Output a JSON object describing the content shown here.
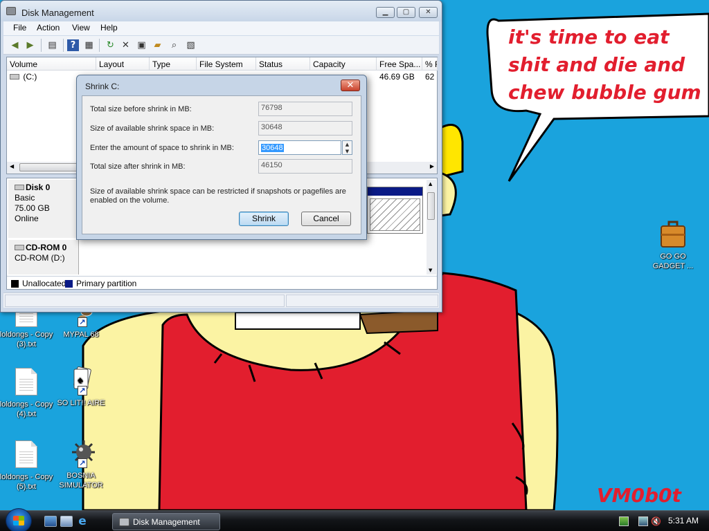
{
  "colors": {
    "desktop_sky": "#1aa3dd",
    "cartoon_red": "#e21e2e",
    "cartoon_skin": "#fbf3a3",
    "cartoon_yellow": "#ffe600",
    "primary_partition": "#0a1a86"
  },
  "wallpaper": {
    "speech_bubble_text": "it's time to eat shit and die and chew bubble gum",
    "signature": "VM0b0t"
  },
  "desktop_icons": [
    {
      "label": "GO GO GADGET ...",
      "icon": "briefcase-icon"
    },
    {
      "label": "loldongs - Copy (3).txt",
      "icon": "text-file-icon"
    },
    {
      "label": "MYPAL 68",
      "icon": "paw-icon"
    },
    {
      "label": "loldongs - Copy (4).txt",
      "icon": "text-file-icon"
    },
    {
      "label": "SO LIT!! AIRE",
      "icon": "cards-icon"
    },
    {
      "label": "loldongs - Copy (5).txt",
      "icon": "text-file-icon"
    },
    {
      "label": "BOSNIA SIMULATOR",
      "icon": "mine-icon"
    }
  ],
  "window": {
    "title": "Disk Management",
    "controls": {
      "minimize": "▁",
      "maximize": "▢",
      "close": "✕"
    },
    "menu": [
      "File",
      "Action",
      "View",
      "Help"
    ],
    "toolbar_icons": [
      "back-arrow-icon",
      "forward-arrow-icon",
      "view-icon",
      "help-icon",
      "properties-icon",
      "refresh-icon",
      "delete-icon",
      "settings-icon",
      "open-folder-icon",
      "search-icon",
      "rescan-icon"
    ],
    "columns": [
      "Volume",
      "Layout",
      "Type",
      "File System",
      "Status",
      "Capacity",
      "Free Spa...",
      "% F"
    ],
    "volume_row": {
      "volume": "(C:)",
      "free_space": "46.69 GB",
      "percent_free": "62"
    },
    "disks": [
      {
        "name": "Disk 0",
        "type": "Basic",
        "size": "75.00 GB",
        "status": "Online"
      },
      {
        "name": "CD-ROM 0",
        "type": "CD-ROM (D:)"
      }
    ],
    "legend": [
      {
        "label": "Unallocated",
        "color": "#000000"
      },
      {
        "label": "Primary partition",
        "color": "#0a1a86"
      }
    ]
  },
  "dialog": {
    "title": "Shrink C:",
    "close_label": "✕",
    "fields": [
      {
        "label": "Total size before shrink in MB:",
        "value": "76798"
      },
      {
        "label": "Size of available shrink space in MB:",
        "value": "30648"
      },
      {
        "label": "Enter the amount of space to shrink in MB:",
        "value": "30648"
      },
      {
        "label": "Total size after shrink in MB:",
        "value": "46150"
      }
    ],
    "note": "Size of available shrink space can be restricted if snapshots or pagefiles are enabled on the volume.",
    "shrink_label": "Shrink",
    "cancel_label": "Cancel"
  },
  "taskbar": {
    "task_button": "Disk Management",
    "clock": "5:31 AM",
    "quick_launch": [
      "show-desktop-icon",
      "switch-windows-icon",
      "internet-explorer-icon"
    ],
    "tray": [
      "network-icon",
      "volume-muted-icon"
    ]
  }
}
